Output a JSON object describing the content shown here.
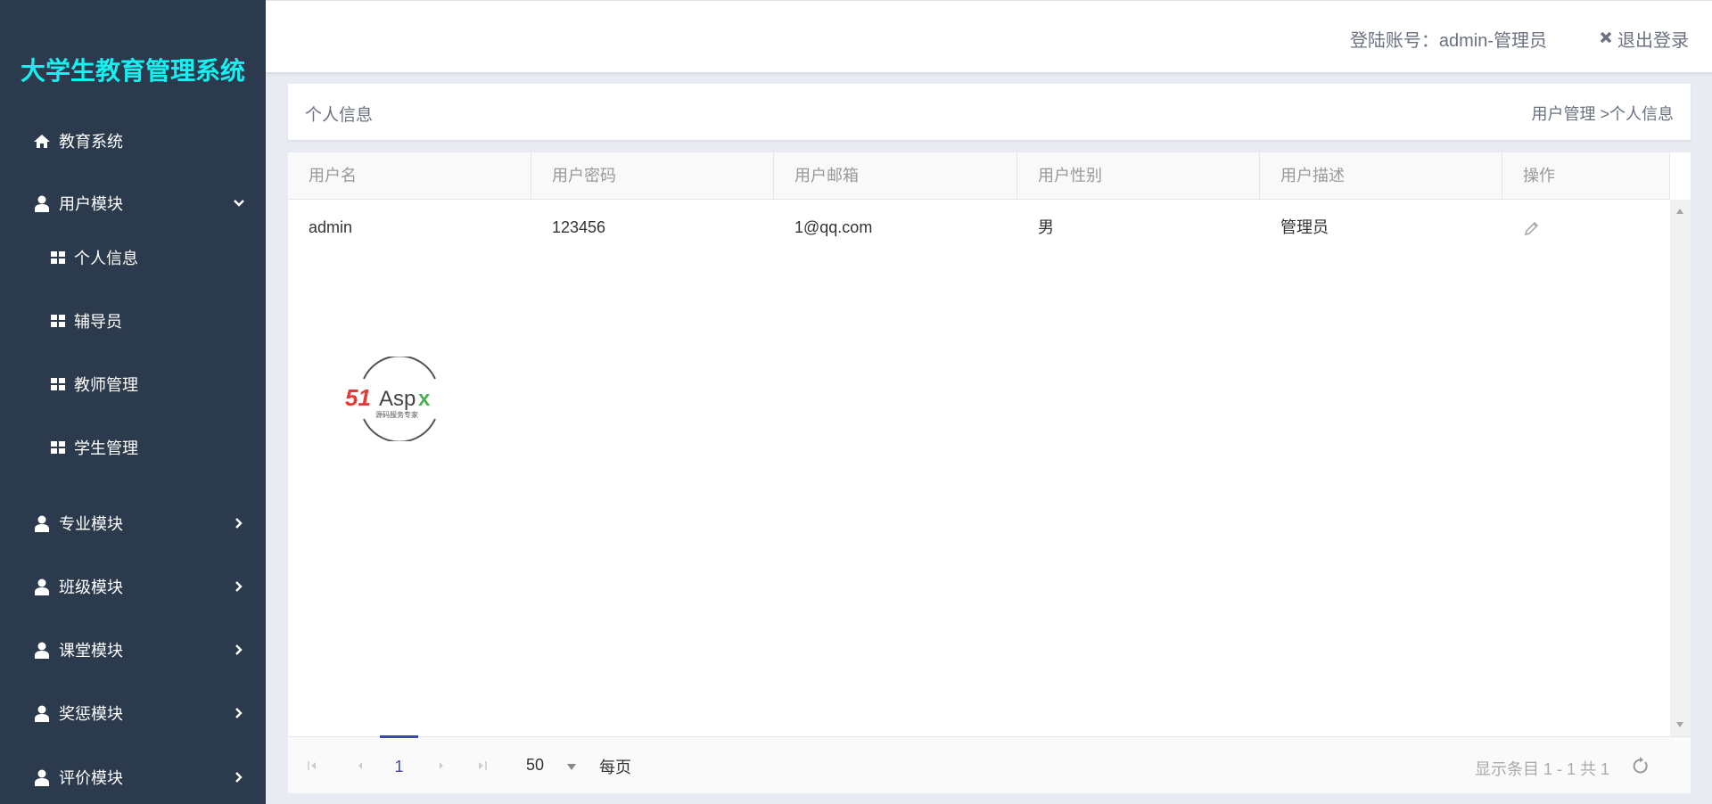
{
  "app_title": "大学生教育管理系统",
  "sidebar": {
    "items": [
      {
        "label": "教育系统",
        "icon": "home-icon"
      },
      {
        "label": "用户模块",
        "icon": "user-icon",
        "expanded": true
      },
      {
        "label": "个人信息",
        "icon": "grid-icon"
      },
      {
        "label": "辅导员",
        "icon": "grid-icon"
      },
      {
        "label": "教师管理",
        "icon": "grid-icon"
      },
      {
        "label": "学生管理",
        "icon": "grid-icon"
      },
      {
        "label": "专业模块",
        "icon": "user-icon"
      },
      {
        "label": "班级模块",
        "icon": "user-icon"
      },
      {
        "label": "课堂模块",
        "icon": "user-icon"
      },
      {
        "label": "奖惩模块",
        "icon": "user-icon"
      },
      {
        "label": "评价模块",
        "icon": "user-icon"
      }
    ]
  },
  "header": {
    "account": "登陆账号：admin-管理员",
    "logout": "退出登录"
  },
  "page": {
    "title": "个人信息",
    "breadcrumb": "用户管理 >个人信息"
  },
  "table": {
    "columns": [
      "用户名",
      "用户密码",
      "用户邮箱",
      "用户性别",
      "用户描述",
      "操作"
    ],
    "rows": [
      [
        "admin",
        "123456",
        "1@qq.com",
        "男",
        "管理员"
      ]
    ]
  },
  "pager": {
    "current_page": "1",
    "page_size": "50",
    "per_page_label": "每页",
    "info": "显示条目 1 - 1 共 1"
  },
  "watermark": {
    "brand": "51Aspx",
    "tagline": "源码服务专家"
  },
  "colors": {
    "sidebar": "#2c3a4d",
    "title": "#16f0f0",
    "accent": "#3b4aa8"
  }
}
